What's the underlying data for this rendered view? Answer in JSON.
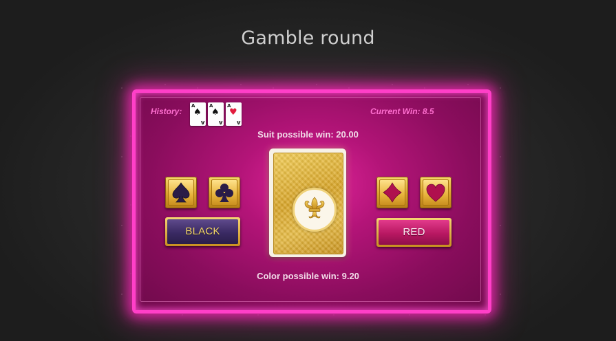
{
  "title": "Gamble round",
  "history": {
    "label": "History:",
    "cards": [
      {
        "rank": "A",
        "suit": "spade",
        "symbol": "♠",
        "color": "#111111"
      },
      {
        "rank": "A",
        "suit": "spade",
        "symbol": "♠",
        "color": "#111111"
      },
      {
        "rank": "A",
        "suit": "heart",
        "symbol": "♥",
        "color": "#e11b3c"
      }
    ]
  },
  "current_win": "Current Win: 8.5",
  "suit_possible_win": "Suit possible win: 20.00",
  "color_possible_win": "Color possible win: 9.20",
  "card_back_icon": "fleur-de-lis-icon",
  "suits": {
    "spade": "spade-icon",
    "club": "club-icon",
    "diamond": "diamond-icon",
    "heart": "heart-icon"
  },
  "buttons": {
    "black": "BLACK",
    "red": "RED"
  },
  "colors": {
    "frame_glow": "#ff3fc8",
    "panel": "#b31478",
    "label_pink": "#ff6fd0",
    "gold": "#e0ab33",
    "black_button": "#3a2a63",
    "red_button": "#b81862"
  }
}
